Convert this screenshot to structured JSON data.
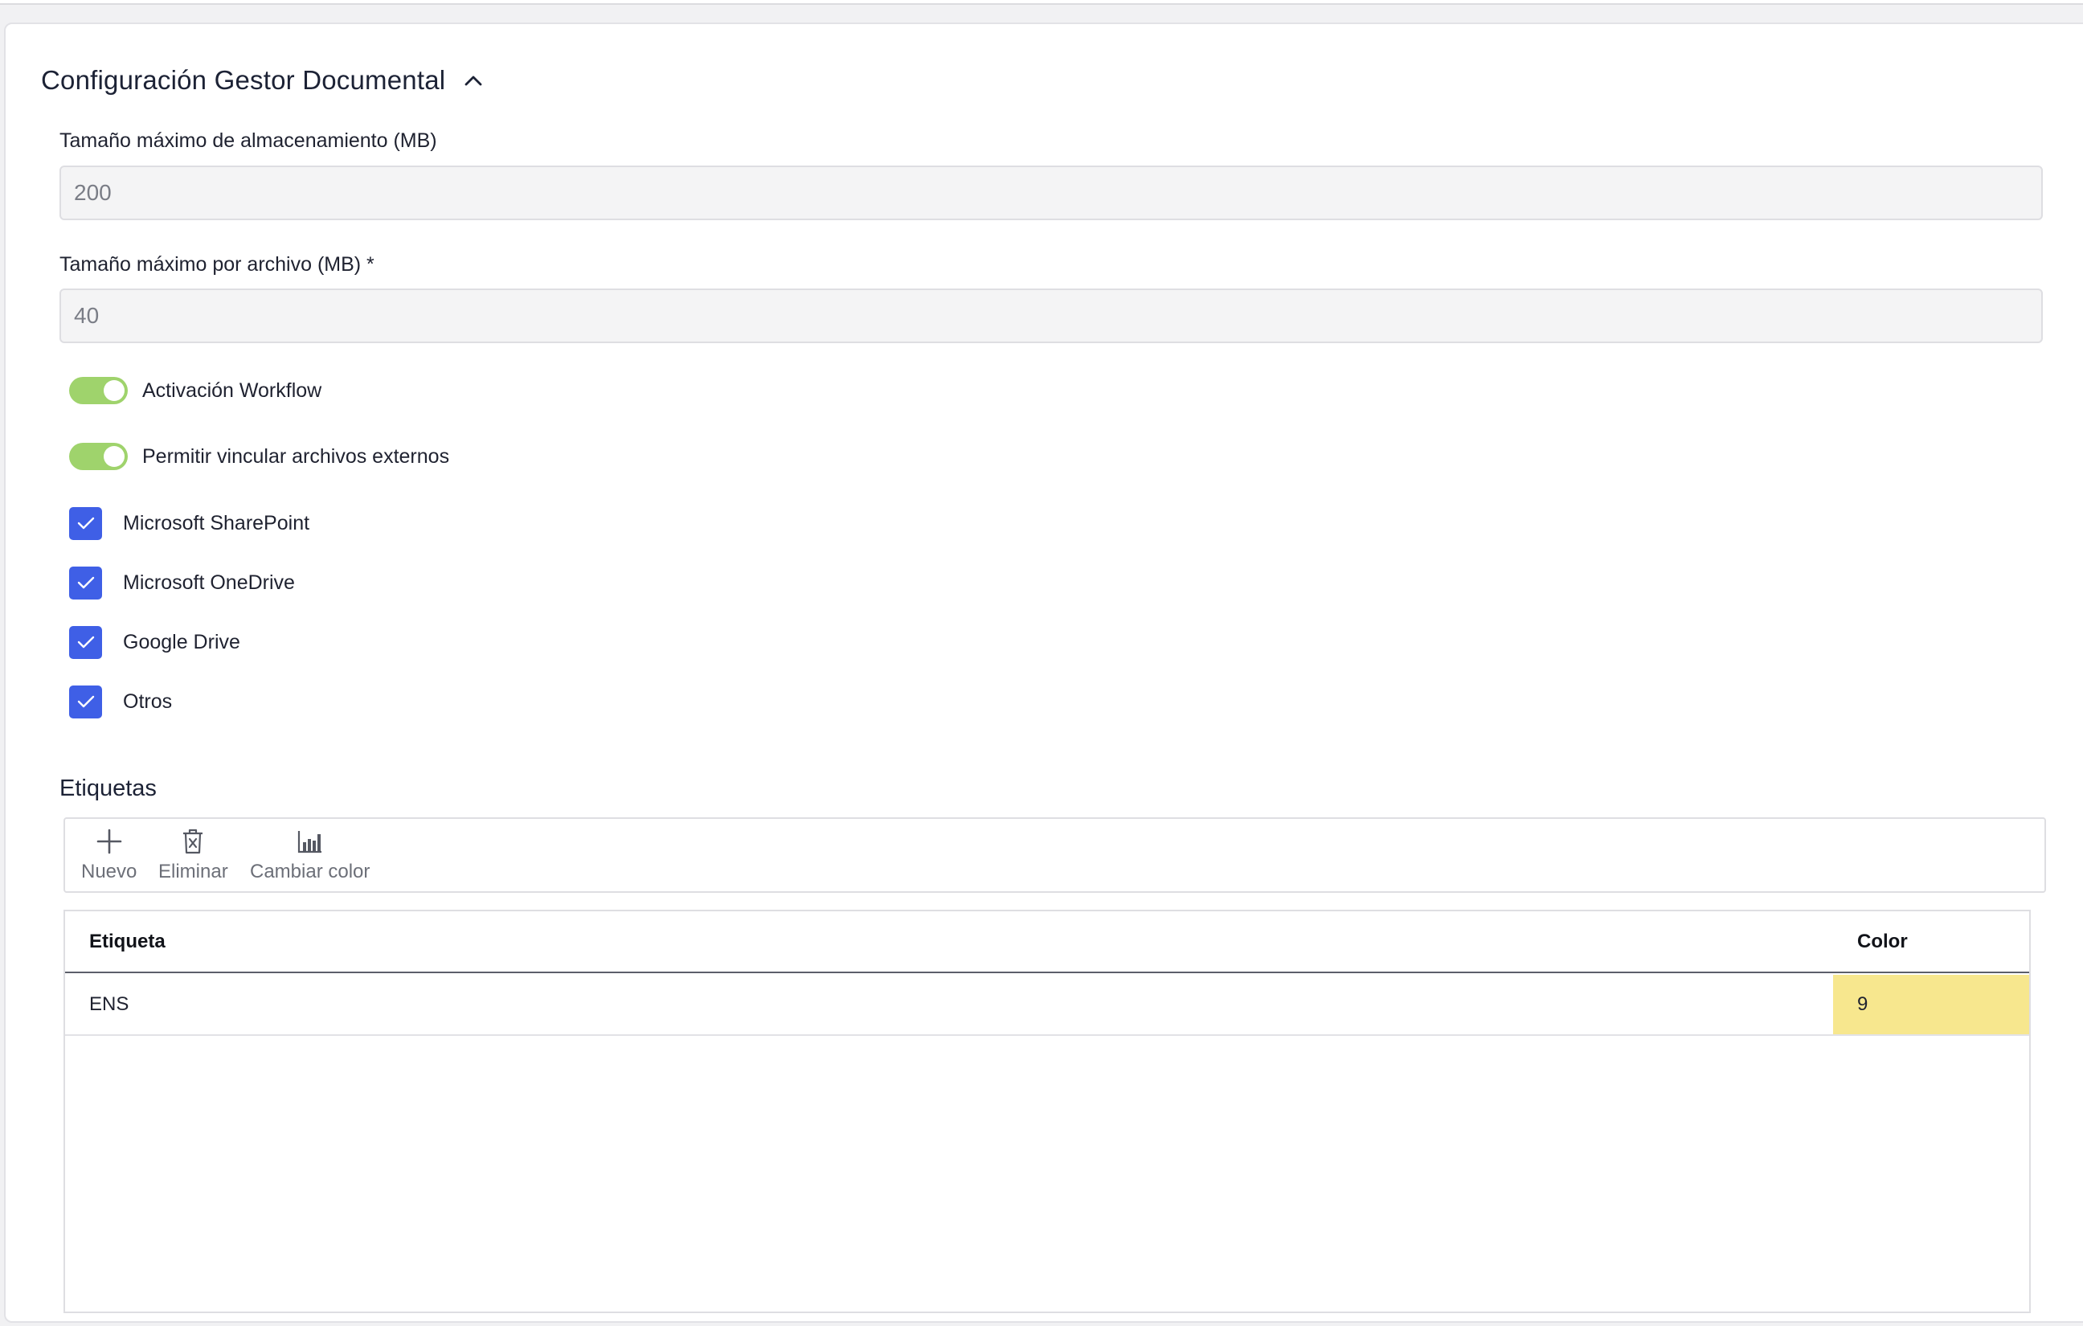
{
  "section": {
    "title": "Configuración Gestor Documental",
    "collapse_icon": "chevron-up-icon"
  },
  "fields": {
    "max_storage": {
      "label": "Tamaño máximo de almacenamiento (MB)",
      "value": "200"
    },
    "max_file": {
      "label": "Tamaño máximo por archivo (MB) *",
      "value": "40"
    }
  },
  "toggles": [
    {
      "label": "Activación Workflow",
      "on": true
    },
    {
      "label": "Permitir vincular archivos externos",
      "on": true
    }
  ],
  "checkboxes": [
    {
      "label": "Microsoft SharePoint",
      "checked": true
    },
    {
      "label": "Microsoft OneDrive",
      "checked": true
    },
    {
      "label": "Google Drive",
      "checked": true
    },
    {
      "label": "Otros",
      "checked": true
    }
  ],
  "tags": {
    "heading": "Etiquetas",
    "toolbar": {
      "new_label": "Nuevo",
      "new_icon": "plus-icon",
      "delete_label": "Eliminar",
      "delete_icon": "trash-icon",
      "color_label": "Cambiar color",
      "color_icon": "bar-chart-icon"
    },
    "columns": [
      "Etiqueta",
      "Color"
    ],
    "rows": [
      {
        "etiqueta": "ENS",
        "color": "9"
      }
    ]
  },
  "colors": {
    "toggle_on": "#9fd36c",
    "checkbox": "#3f5fe6",
    "color_cell": "#f7e78e"
  }
}
